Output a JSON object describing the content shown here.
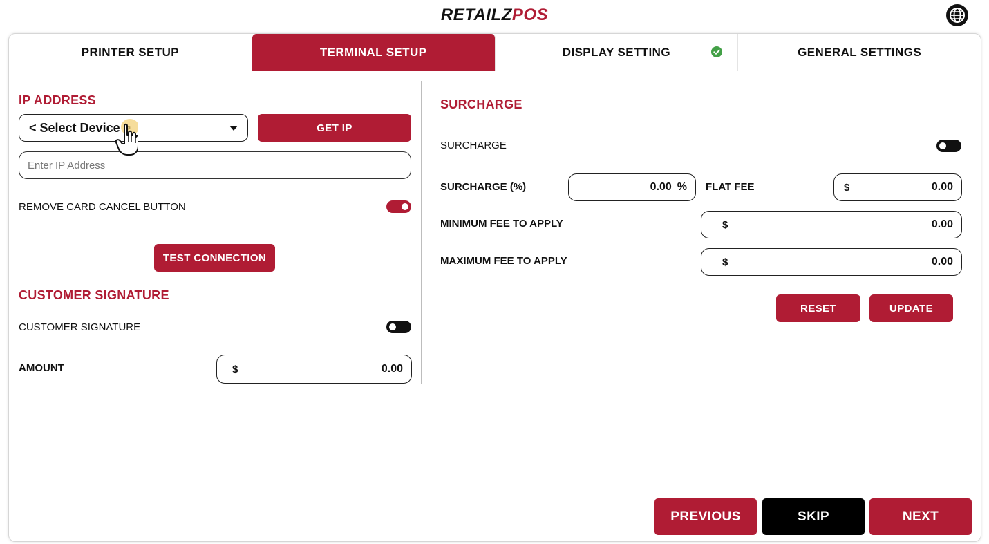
{
  "brand": {
    "part1": "RETAILZ",
    "part2": "POS"
  },
  "tabs": [
    {
      "label": "PRINTER SETUP",
      "active": false
    },
    {
      "label": "TERMINAL SETUP",
      "active": true
    },
    {
      "label": "DISPLAY SETTING",
      "active": false,
      "completed": true
    },
    {
      "label": "GENERAL SETTINGS",
      "active": false
    }
  ],
  "ip_section": {
    "title": "IP ADDRESS",
    "device_select": "< Select Device >",
    "get_ip_label": "GET IP",
    "ip_placeholder": "Enter IP Address",
    "remove_card_cancel_label": "REMOVE CARD CANCEL BUTTON",
    "remove_card_cancel_on": true,
    "test_connection_label": "TEST CONNECTION"
  },
  "signature_section": {
    "title": "CUSTOMER SIGNATURE",
    "toggle_label": "CUSTOMER SIGNATURE",
    "toggle_on": false,
    "amount_label": "AMOUNT",
    "amount_currency": "$",
    "amount_value": "0.00"
  },
  "surcharge_section": {
    "title": "SURCHARGE",
    "toggle_label": "SURCHARGE",
    "toggle_on": false,
    "percent_label": "SURCHARGE (%)",
    "percent_value": "0.00",
    "percent_symbol": "%",
    "flat_fee_label": "FLAT FEE",
    "flat_fee_currency": "$",
    "flat_fee_value": "0.00",
    "min_fee_label": "MINIMUM FEE TO APPLY",
    "min_fee_currency": "$",
    "min_fee_value": "0.00",
    "max_fee_label": "MAXIMUM FEE TO APPLY",
    "max_fee_currency": "$",
    "max_fee_value": "0.00",
    "reset_label": "RESET",
    "update_label": "UPDATE"
  },
  "footer": {
    "previous_label": "PREVIOUS",
    "skip_label": "SKIP",
    "next_label": "NEXT"
  },
  "colors": {
    "accent": "#b01c34",
    "dark": "#000000",
    "success": "#43a047"
  },
  "icons": {
    "language": "globe-icon",
    "completed": "check-circle-icon",
    "dropdown": "caret-down-icon",
    "pointer": "hand-cursor-icon"
  }
}
